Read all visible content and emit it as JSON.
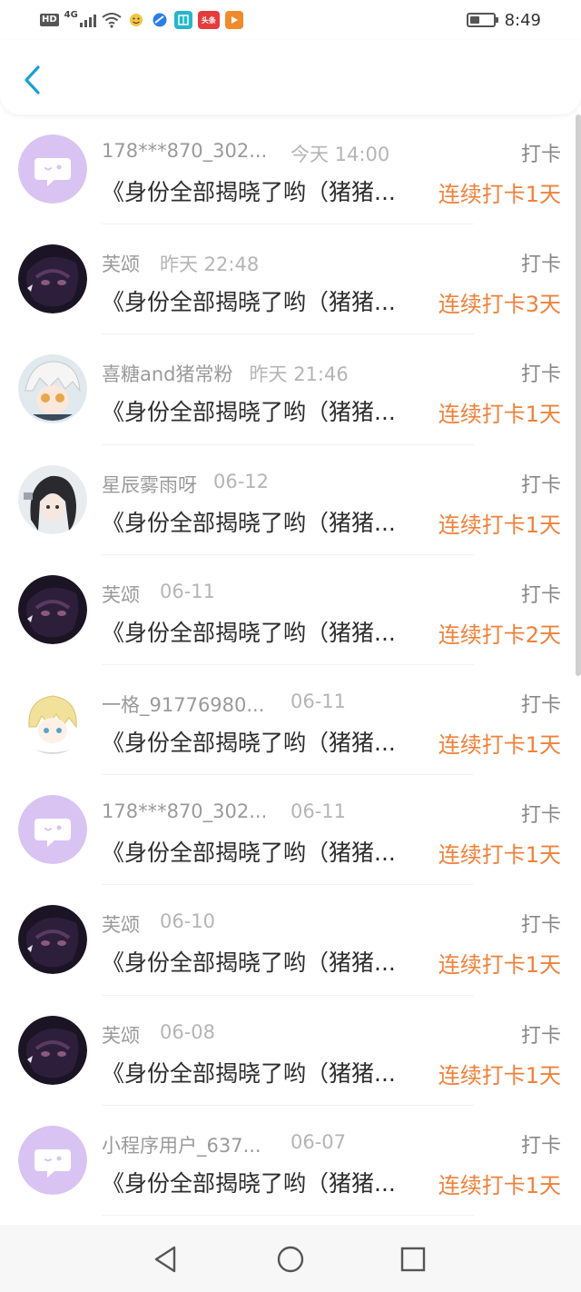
{
  "status_bar": {
    "hd": "HD",
    "network": "4G",
    "time": "8:49",
    "battery_level": 0.45,
    "app_icons": [
      "smiley-icon",
      "browser-icon",
      "book-icon",
      "toutiao-icon",
      "video-icon"
    ],
    "toutiao_label": "头条"
  },
  "header": {
    "back_icon": "chevron-left-icon",
    "accent": "#1a9fd8"
  },
  "colors": {
    "streak": "#f0813a",
    "name": "#9a9a9a",
    "time": "#b5b5b5",
    "avatar_default": "#d9c3f3"
  },
  "items": [
    {
      "name": "178***870_302...",
      "time": "今天 14:00",
      "type": "打卡",
      "title": "《身份全部揭晓了哟（猪猪...",
      "streak": "连续打卡1天",
      "avatar": "default-avatar-icon"
    },
    {
      "name": "芙颂",
      "time": "昨天 22:48",
      "type": "打卡",
      "title": "《身份全部揭晓了哟（猪猪...",
      "streak": "连续打卡3天",
      "avatar": "dark-anime-avatar"
    },
    {
      "name": "喜糖and猪常粉",
      "time": "昨天 21:46",
      "type": "打卡",
      "title": "《身份全部揭晓了哟（猪猪...",
      "streak": "连续打卡1天",
      "avatar": "white-hair-anime-avatar"
    },
    {
      "name": "星辰雾雨呀",
      "time": "06-12",
      "type": "打卡",
      "title": "《身份全部揭晓了哟（猪猪...",
      "streak": "连续打卡1天",
      "avatar": "black-hair-anime-avatar"
    },
    {
      "name": "芙颂",
      "time": "06-11",
      "type": "打卡",
      "title": "《身份全部揭晓了哟（猪猪...",
      "streak": "连续打卡2天",
      "avatar": "dark-anime-avatar"
    },
    {
      "name": "一格_91776980...",
      "time": "06-11",
      "type": "打卡",
      "title": "《身份全部揭晓了哟（猪猪...",
      "streak": "连续打卡1天",
      "avatar": "blonde-anime-avatar"
    },
    {
      "name": "178***870_302...",
      "time": "06-11",
      "type": "打卡",
      "title": "《身份全部揭晓了哟（猪猪...",
      "streak": "连续打卡1天",
      "avatar": "default-avatar-icon"
    },
    {
      "name": "芙颂",
      "time": "06-10",
      "type": "打卡",
      "title": "《身份全部揭晓了哟（猪猪...",
      "streak": "连续打卡1天",
      "avatar": "dark-anime-avatar"
    },
    {
      "name": "芙颂",
      "time": "06-08",
      "type": "打卡",
      "title": "《身份全部揭晓了哟（猪猪...",
      "streak": "连续打卡1天",
      "avatar": "dark-anime-avatar"
    },
    {
      "name": "小程序用户_637...",
      "time": "06-07",
      "type": "打卡",
      "title": "《身份全部揭晓了哟（猪猪...",
      "streak": "连续打卡1天",
      "avatar": "default-avatar-icon"
    }
  ],
  "navbar": {
    "back": "triangle-back-icon",
    "home": "circle-home-icon",
    "recents": "square-recents-icon"
  }
}
